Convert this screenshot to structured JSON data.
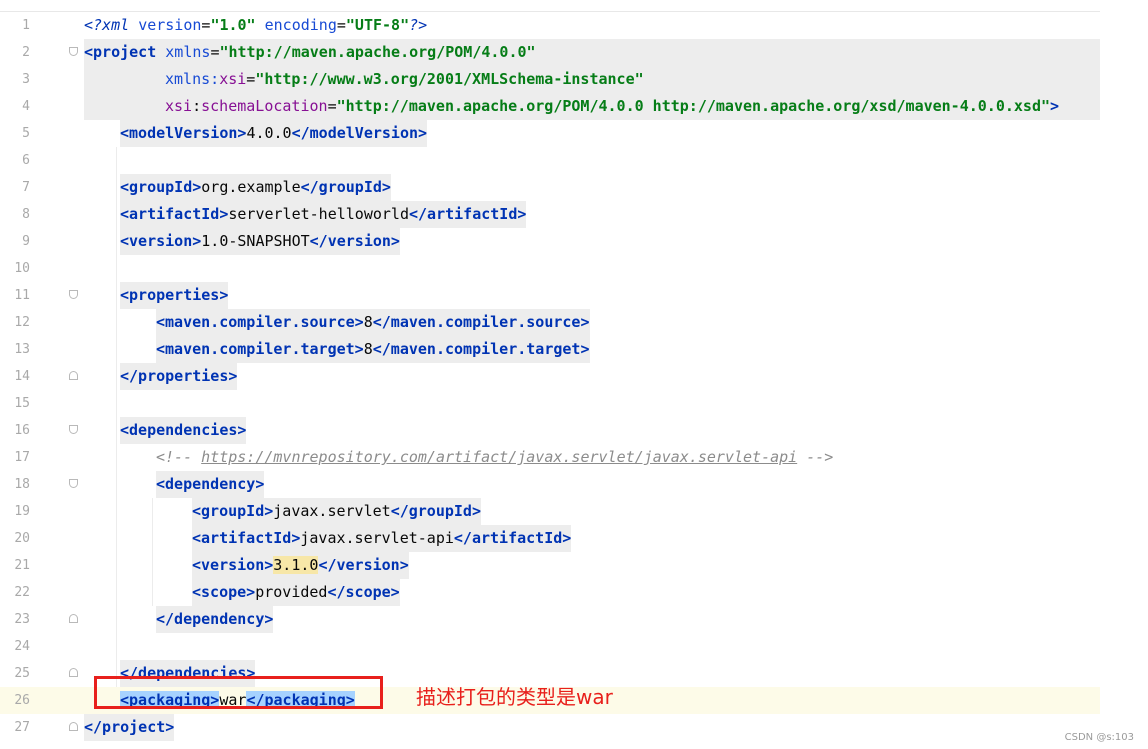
{
  "lines": [
    {
      "n": "1"
    },
    {
      "n": "2"
    },
    {
      "n": "3"
    },
    {
      "n": "4"
    },
    {
      "n": "5"
    },
    {
      "n": "6"
    },
    {
      "n": "7"
    },
    {
      "n": "8"
    },
    {
      "n": "9"
    },
    {
      "n": "10"
    },
    {
      "n": "11"
    },
    {
      "n": "12"
    },
    {
      "n": "13"
    },
    {
      "n": "14"
    },
    {
      "n": "15"
    },
    {
      "n": "16"
    },
    {
      "n": "17"
    },
    {
      "n": "18"
    },
    {
      "n": "19"
    },
    {
      "n": "20"
    },
    {
      "n": "21"
    },
    {
      "n": "22"
    },
    {
      "n": "23"
    },
    {
      "n": "24"
    },
    {
      "n": "25"
    },
    {
      "n": "26"
    },
    {
      "n": "27"
    }
  ],
  "code": {
    "xml_decl": {
      "open": "<?xml",
      "a1": "version",
      "v1": "\"1.0\"",
      "a2": "encoding",
      "v2": "\"UTF-8\"",
      "close": "?>"
    },
    "project_open": {
      "tag": "<project",
      "a1": "xmlns",
      "v1": "\"http://maven.apache.org/POM/4.0.0\""
    },
    "xsi_line": {
      "ns": "xmlns",
      "colon": ":",
      "a": "xsi",
      "eq": "=",
      "v": "\"http://www.w3.org/2001/XMLSchema-instance\""
    },
    "schema_line": {
      "ns": "xsi",
      "colon": ":",
      "a": "schemaLocation",
      "eq": "=",
      "v": "\"http://maven.apache.org/POM/4.0.0 http://maven.apache.org/xsd/maven-4.0.0.xsd\"",
      "close": ">"
    },
    "model_version": {
      "open": "<modelVersion>",
      "text": "4.0.0",
      "close": "</modelVersion>"
    },
    "group_id": {
      "open": "<groupId>",
      "text": "org.example",
      "close": "</groupId>"
    },
    "artifact_id": {
      "open": "<artifactId>",
      "text": "serverlet-helloworld",
      "close": "</artifactId>"
    },
    "version": {
      "open": "<version>",
      "text": "1.0-SNAPSHOT",
      "close": "</version>"
    },
    "properties_open": "<properties>",
    "compiler_source": {
      "open": "<maven.compiler.source>",
      "text": "8",
      "close": "</maven.compiler.source>"
    },
    "compiler_target": {
      "open": "<maven.compiler.target>",
      "text": "8",
      "close": "</maven.compiler.target>"
    },
    "properties_close": "</properties>",
    "dependencies_open": "<dependencies>",
    "comment": {
      "open": "<!-- ",
      "link": "https://mvnrepository.com/artifact/javax.servlet/javax.servlet-api",
      "close": " -->"
    },
    "dependency_open": "<dependency>",
    "dep_group_id": {
      "open": "<groupId>",
      "text": "javax.servlet",
      "close": "</groupId>"
    },
    "dep_artifact_id": {
      "open": "<artifactId>",
      "text": "javax.servlet-api",
      "close": "</artifactId>"
    },
    "dep_version": {
      "open": "<version>",
      "text": "3.1.0",
      "close": "</version>"
    },
    "dep_scope": {
      "open": "<scope>",
      "text": "provided",
      "close": "</scope>"
    },
    "dependency_close": "</dependency>",
    "dependencies_close": "</dependencies>",
    "packaging": {
      "open": "<packaging>",
      "text": "war",
      "close": "</packaging>"
    },
    "project_close": "</project>"
  },
  "annotation": {
    "text": "描述打包的类型是war"
  },
  "watermark": "CSDN @s:103",
  "colors": {
    "tag": "#0033b3",
    "attr_value": "#067d17",
    "namespace": "#871094",
    "comment": "#8c8c8c",
    "selection": "#a6d2ff",
    "annotation": "#e8201c"
  }
}
